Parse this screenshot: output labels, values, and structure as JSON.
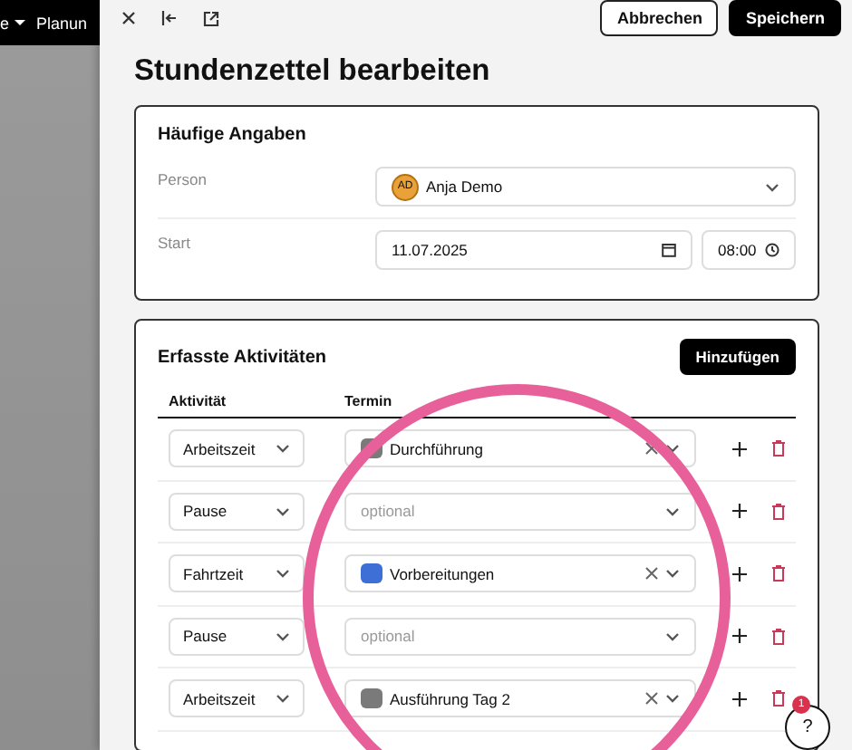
{
  "background_app": {
    "nav_items": [
      {
        "label": "e",
        "dropdown": true
      },
      {
        "label": "Planun",
        "dropdown": false
      }
    ]
  },
  "toolbar": {
    "cancel_button": "Abbrechen",
    "save_button": "Speichern"
  },
  "title": "Stundenzettel bearbeiten",
  "common": {
    "heading": "Häufige Angaben",
    "person_label": "Person",
    "person": {
      "initials": "AD",
      "name": "Anja Demo"
    },
    "start_label": "Start",
    "date": "11.07.2025",
    "time": "08:00"
  },
  "activities": {
    "heading": "Erfasste Aktivitäten",
    "add_button": "Hinzufügen",
    "columns": [
      "Aktivität",
      "Termin"
    ],
    "rows": [
      {
        "activity": "Arbeitszeit",
        "appointment": {
          "label": "Durchführung",
          "color": "#7a7a7a"
        }
      },
      {
        "activity": "Pause",
        "placeholder": "optional"
      },
      {
        "activity": "Fahrtzeit",
        "appointment": {
          "label": "Vorbereitungen",
          "color": "#3d6fd6"
        }
      },
      {
        "activity": "Pause",
        "placeholder": "optional"
      },
      {
        "activity": "Arbeitszeit",
        "appointment": {
          "label": "Ausführung Tag 2",
          "color": "#7a7a7a"
        }
      }
    ]
  },
  "help": {
    "label": "?",
    "badge": "1"
  }
}
